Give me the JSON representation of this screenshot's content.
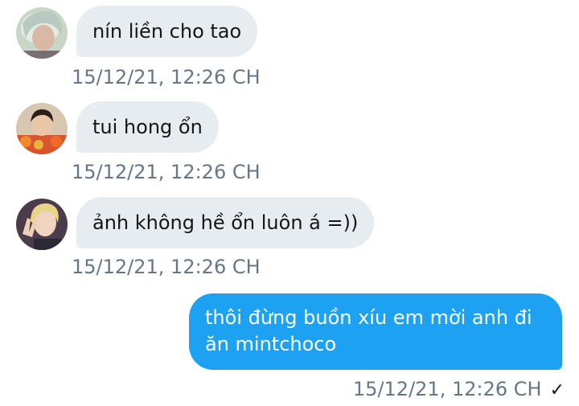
{
  "messages": [
    {
      "direction": "incoming",
      "avatar_icon": "user-avatar-1",
      "text": "nín liền cho tao",
      "timestamp": "15/12/21, 12:26 CH"
    },
    {
      "direction": "incoming",
      "avatar_icon": "user-avatar-2",
      "text": "tui hong ổn",
      "timestamp": "15/12/21, 12:26 CH"
    },
    {
      "direction": "incoming",
      "avatar_icon": "user-avatar-3",
      "text": "ảnh không hề ổn luôn á =))",
      "timestamp": "15/12/21, 12:26 CH"
    },
    {
      "direction": "outgoing",
      "text": "thôi đừng buồn xíu em mời anh đi ăn mintchoco",
      "timestamp": "15/12/21, 12:26 CH",
      "status_icon": "checkmark-icon",
      "status_glyph": "✓"
    }
  ],
  "colors": {
    "incoming_bubble": "#e7ecf0",
    "outgoing_bubble": "#1da1f2",
    "timestamp": "#657786"
  }
}
